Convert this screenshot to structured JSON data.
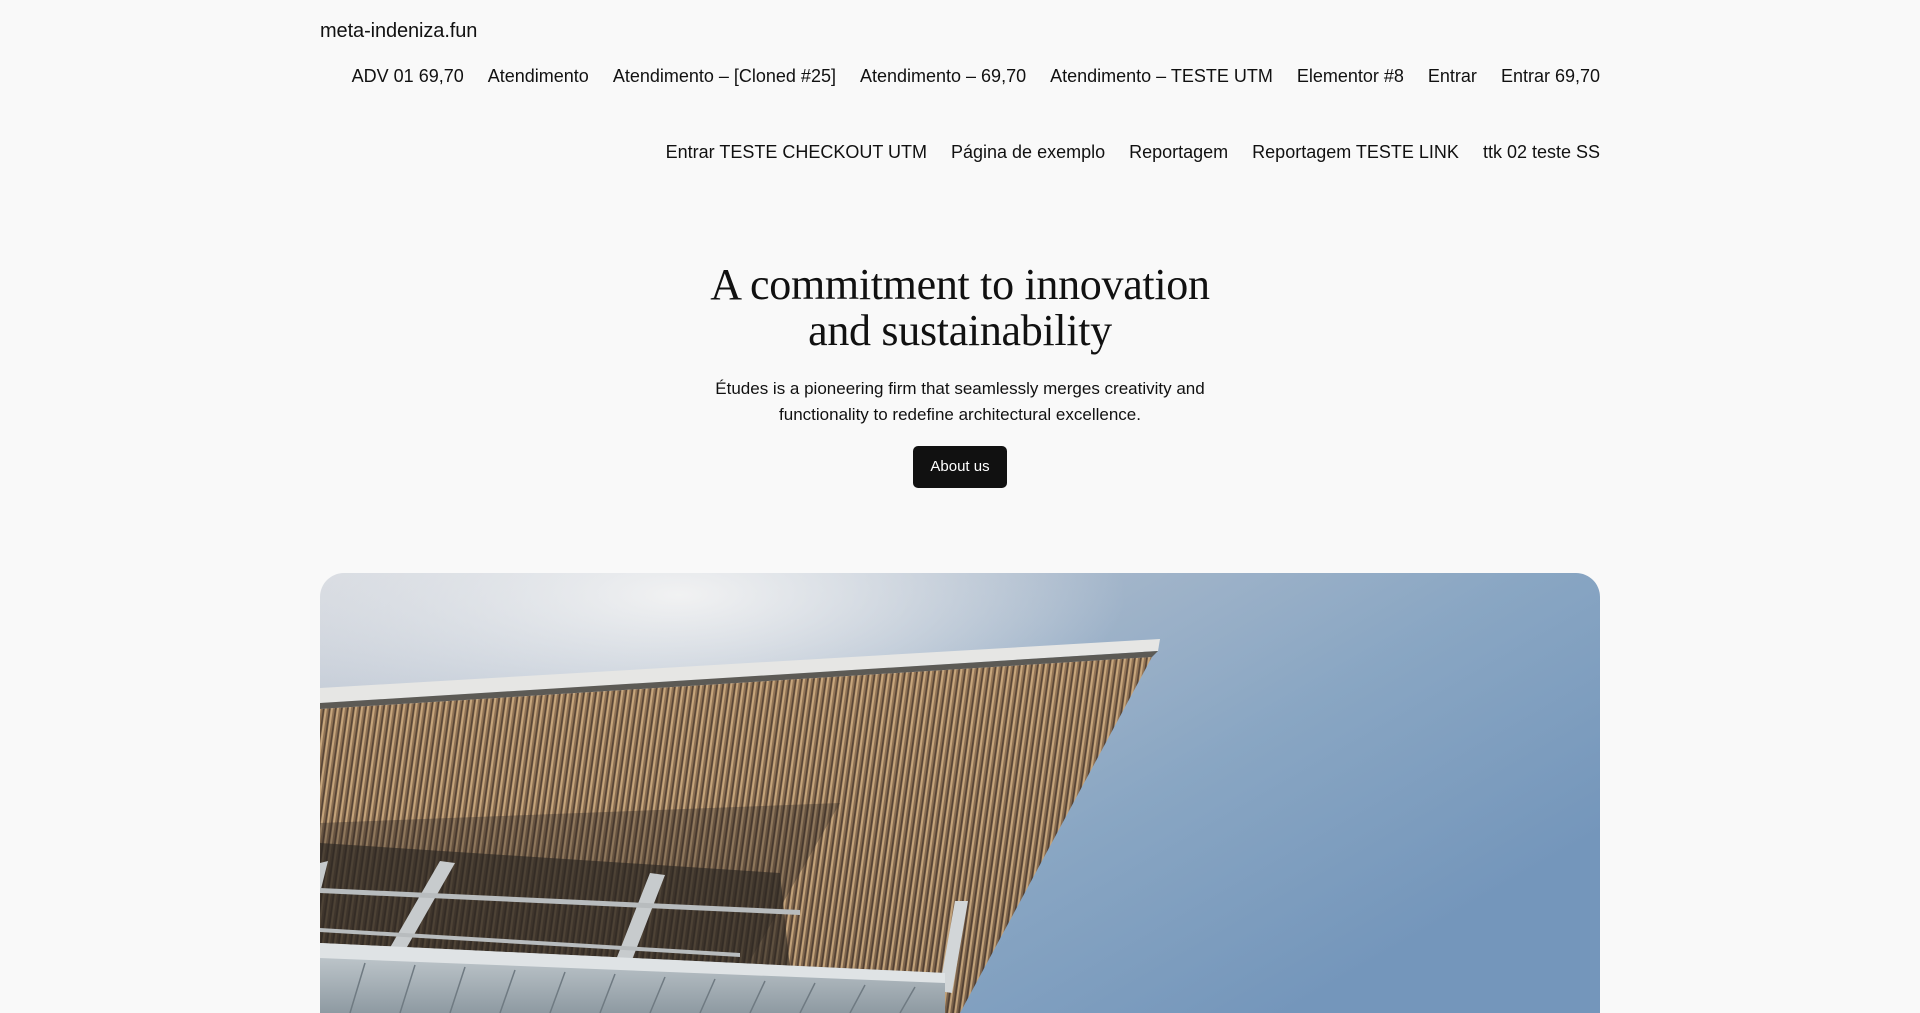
{
  "header": {
    "site_title": "meta-indeniza.fun",
    "nav_row1": [
      "ADV 01 69,70",
      "Atendimento",
      "Atendimento – [Cloned #25]",
      "Atendimento – 69,70",
      "Atendimento – TESTE UTM",
      "Elementor #8",
      "Entrar",
      "Entrar 69,70"
    ],
    "nav_row2": [
      "Entrar TESTE CHECKOUT UTM",
      "Página de exemplo",
      "Reportagem",
      "Reportagem TESTE LINK",
      "ttk 02 teste SS"
    ]
  },
  "hero": {
    "title_line1": "A commitment to innovation",
    "title_line2": "and sustainability",
    "description": "Études is a pioneering firm that seamlessly merges creativity and functionality to redefine architectural excellence.",
    "cta_label": "About us",
    "image_alt": "Building exterior with wooden slatted canopy against a blue sky"
  },
  "colors": {
    "background": "#f9f9f9",
    "text": "#111111",
    "button_bg": "#111111",
    "button_text": "#ffffff",
    "sky": "#8aa8c6"
  }
}
